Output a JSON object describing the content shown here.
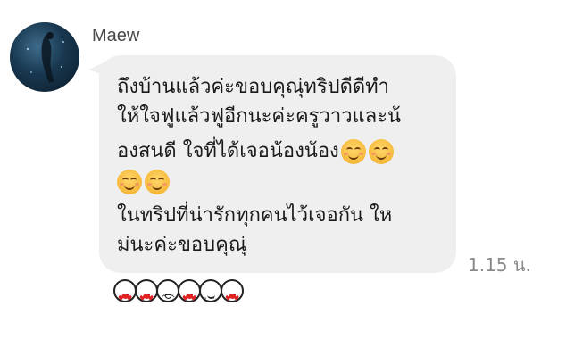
{
  "message": {
    "sender": "Maew",
    "lines": [
      "ถึงบ้านแล้วค่ะขอบคุณุ่ทริปดีดีทำ",
      " ให้ใจฟูแล้วฟูอีกนะค่ะครูวาวและน้",
      "องสนดี ใจที่ได้เจอน้องน้อง",
      "",
      " ในทริปที่น่ารักทุกคนไว้เจอกัน ให",
      "ม่นะค่ะขอบคุณุ่"
    ],
    "emoji_icon": "smiling-face-emoji",
    "time": "1.15 น."
  },
  "reactions": [
    {
      "icon": "heart-eyes-sticker"
    },
    {
      "icon": "heart-eyes-sticker"
    },
    {
      "icon": "shy-face-sticker"
    },
    {
      "icon": "heart-eyes-sticker"
    },
    {
      "icon": "grin-face-sticker"
    },
    {
      "icon": "heart-eyes-sticker"
    }
  ],
  "colors": {
    "bubble": "#efefef",
    "text": "#1a1a1a",
    "meta": "#8a8a8a",
    "accent_heart": "#e02424"
  }
}
